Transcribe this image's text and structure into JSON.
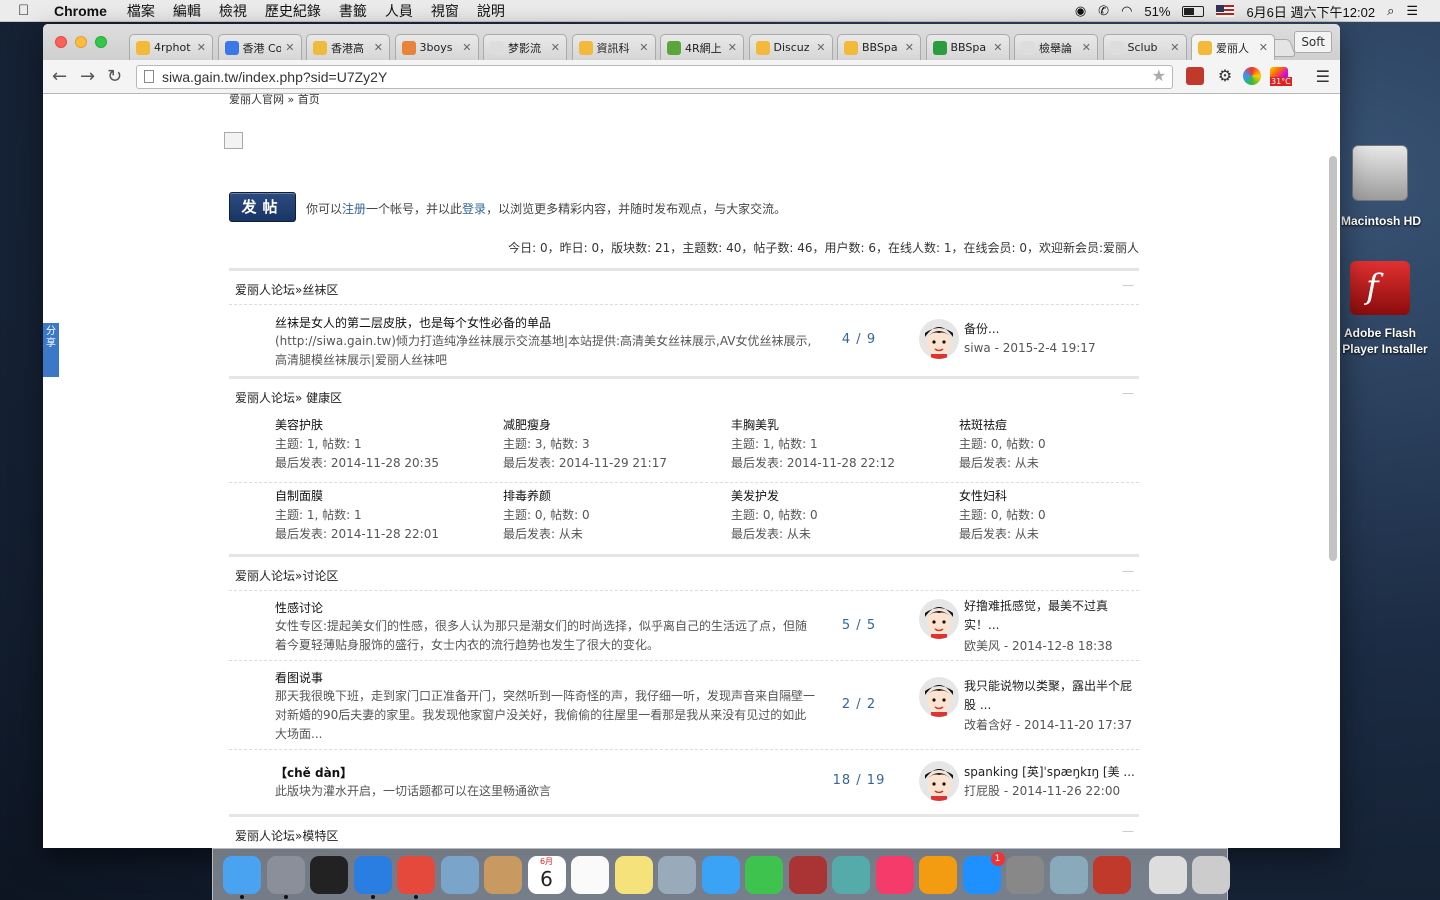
{
  "menubar": {
    "app": "Chrome",
    "items": [
      "檔案",
      "編輯",
      "檢視",
      "歷史紀錄",
      "書籤",
      "人員",
      "視窗",
      "說明"
    ],
    "battery": "51%",
    "datetime": "6月6日 週六下午12:02"
  },
  "tabs": [
    {
      "title": "4rphot",
      "color": "#f2b93b"
    },
    {
      "title": "香港 Co",
      "color": "#3b78e7"
    },
    {
      "title": "香港高",
      "color": "#f2b93b"
    },
    {
      "title": "3boys",
      "color": "#e8833a"
    },
    {
      "title": "梦影流",
      "color": "#ddd"
    },
    {
      "title": "資訊科",
      "color": "#f2b93b"
    },
    {
      "title": "4R網上",
      "color": "#5aa63a"
    },
    {
      "title": "Discuz",
      "color": "#f2b93b"
    },
    {
      "title": "BBSpa",
      "color": "#f2b93b"
    },
    {
      "title": "BBSpa",
      "color": "#2e9b3e"
    },
    {
      "title": "檢舉論",
      "color": "#ddd"
    },
    {
      "title": "Sclub",
      "color": "#ddd"
    },
    {
      "title": "爱丽人",
      "color": "#f2b93b"
    }
  ],
  "toolbar": {
    "url": "siwa.gain.tw/index.php?sid=U7Zy2Y",
    "soft": "Soft",
    "weather": "31°C"
  },
  "page": {
    "breadcrumb": "爱丽人官网 » 首页",
    "post_button": "发帖",
    "intro_pre": "你可以",
    "register": "注册",
    "intro_mid": "一个帐号，并以此",
    "login": "登录",
    "intro_post": "，以浏览更多精彩内容，并随时发布观点，与大家交流。",
    "stats": "今日: 0，昨日: 0，版块数: 21，主题数: 40，帖子数: 46，用户数: 6，在线人数: 1，在线会员: 0，欢迎新会员:爱丽人",
    "collapse": "一",
    "sections": [
      {
        "title": "爱丽人论坛»丝袜区"
      },
      {
        "title": "爱丽人论坛» 健康区"
      },
      {
        "title": "爱丽人论坛»讨论区"
      },
      {
        "title": "爱丽人论坛»模特区"
      }
    ],
    "silk": {
      "name": "丝袜是女人的第二层皮肤，也是每个女性必备的单品",
      "desc": "(http://siwa.gain.tw)倾力打造纯净丝袜展示交流基地|本站提供:高清美女丝袜展示,AV女优丝袜展示,高清腿模丝袜展示|爱丽人丝袜吧",
      "count": "4 / 9",
      "last_title": "备份...",
      "last_meta": "siwa - 2015-2-4 19:17"
    },
    "health": [
      {
        "name": "美容护肤",
        "stat": "主题: 1, 帖数: 1",
        "last": "最后发表: 2014-11-28 20:35"
      },
      {
        "name": "减肥瘦身",
        "stat": "主题: 3, 帖数: 3",
        "last": "最后发表: 2014-11-29 21:17"
      },
      {
        "name": "丰胸美乳",
        "stat": "主题: 1, 帖数: 1",
        "last": "最后发表: 2014-11-28 22:12"
      },
      {
        "name": "祛斑祛痘",
        "stat": "主题: 0, 帖数: 0",
        "last": "最后发表: 从未"
      },
      {
        "name": "自制面膜",
        "stat": "主题: 1, 帖数: 1",
        "last": "最后发表: 2014-11-28 22:01"
      },
      {
        "name": "排毒养颜",
        "stat": "主题: 0, 帖数: 0",
        "last": "最后发表: 从未"
      },
      {
        "name": "美发护发",
        "stat": "主题: 0, 帖数: 0",
        "last": "最后发表: 从未"
      },
      {
        "name": "女性妇科",
        "stat": "主题: 0, 帖数: 0",
        "last": "最后发表: 从未"
      }
    ],
    "discuss": [
      {
        "name": "性感讨论",
        "desc": "女性专区:提起美女们的性感，很多人认为那只是潮女们的时尚选择，似乎离自己的生活远了点，但随着今夏轻薄贴身服饰的盛行，女士内衣的流行趋势也发生了很大的变化。",
        "count": "5 / 5",
        "last_title": "好撸难抵感觉，最美不过真实！...",
        "last_meta": "欧美风 - 2014-12-8 18:38"
      },
      {
        "name": "看图说事",
        "desc": "那天我很晚下班，走到家门口正准备开门，突然听到一阵奇怪的声，我仔细一听，发现声音来自隔壁一对新婚的90后夫妻的家里。我发现他家窗户没关好，我偷偷的往屋里一看那是我从来没有见过的如此大场面...",
        "count": "2 / 2",
        "last_title": "我只能说物以类聚，露出半个屁股 ...",
        "last_meta": "改着含好 - 2014-11-20 17:37"
      },
      {
        "name": "【chě dàn】",
        "desc": "此版块为灌水开启，一切话题都可以在这里畅通欲言",
        "count": "18 / 19",
        "last_title": "spanking [英]ˈspæŋkɪŋ [美 ...",
        "last_meta": "打屁股 - 2014-11-26 22:00"
      }
    ],
    "share": "分享"
  },
  "desktop": {
    "hd": "Macintosh HD",
    "flash1": "Adobe Flash",
    "flash2": "Player Installer"
  },
  "dock": [
    "Finder",
    "Launchpad",
    "Dashboard",
    "Safari",
    "Chrome",
    "Mail",
    "Contacts",
    "Calendar",
    "Reminders",
    "Notes",
    "Preview",
    "Messages",
    "FaceTime",
    "Photo Booth",
    "iPhoto",
    "iTunes",
    "iBooks",
    "App Store",
    "System Preferences",
    "Migration",
    "FileZilla",
    "Downloads",
    "Trash"
  ],
  "calendar_day": "6",
  "calendar_month": "6月",
  "appstore_badge": "1"
}
